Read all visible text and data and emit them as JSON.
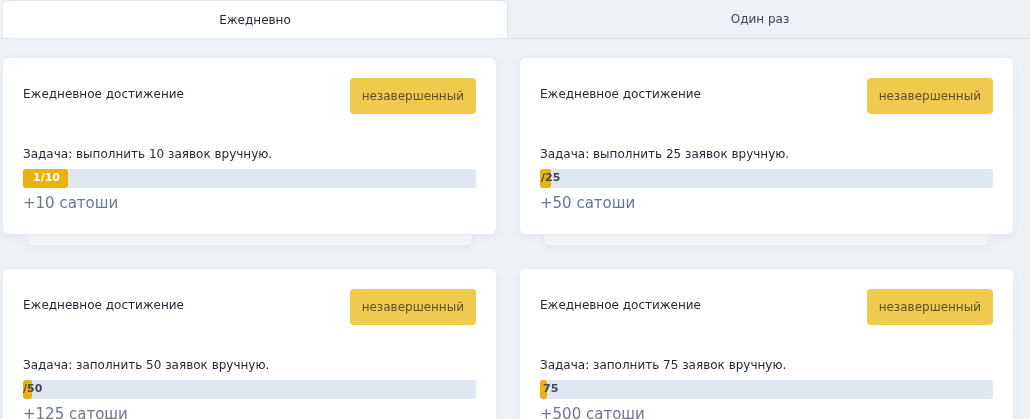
{
  "tabs": [
    {
      "label": "Ежедневно",
      "selected": true
    },
    {
      "label": "Один раз",
      "selected": false
    }
  ],
  "cards": [
    {
      "title": "Ежедневное достижение",
      "status": "незавершенный",
      "task": "Задача: выполнить 10 заявок вручную.",
      "progress_label": "1/10",
      "level": 0.1,
      "reward": "+10 сатоши"
    },
    {
      "title": "Ежедневное достижение",
      "status": "незавершенный",
      "task": "Задача: выполнить 25 заявок вручную.",
      "progress_label": "/25",
      "level": 0.025,
      "reward": "+50 сатоши"
    },
    {
      "title": "Ежедневное достижение",
      "status": "незавершенный",
      "task": "Задача: заполнить 50 заявок вручную.",
      "progress_label": "/50",
      "level": 0.02,
      "reward": "+125 сатоши"
    },
    {
      "title": "Ежедневное достижение",
      "status": "незавершенный",
      "task": "Задача: заполнить 75 заявок вручную.",
      "progress_label": "75",
      "level": 0.015,
      "reward": "+500 сатоши"
    }
  ]
}
